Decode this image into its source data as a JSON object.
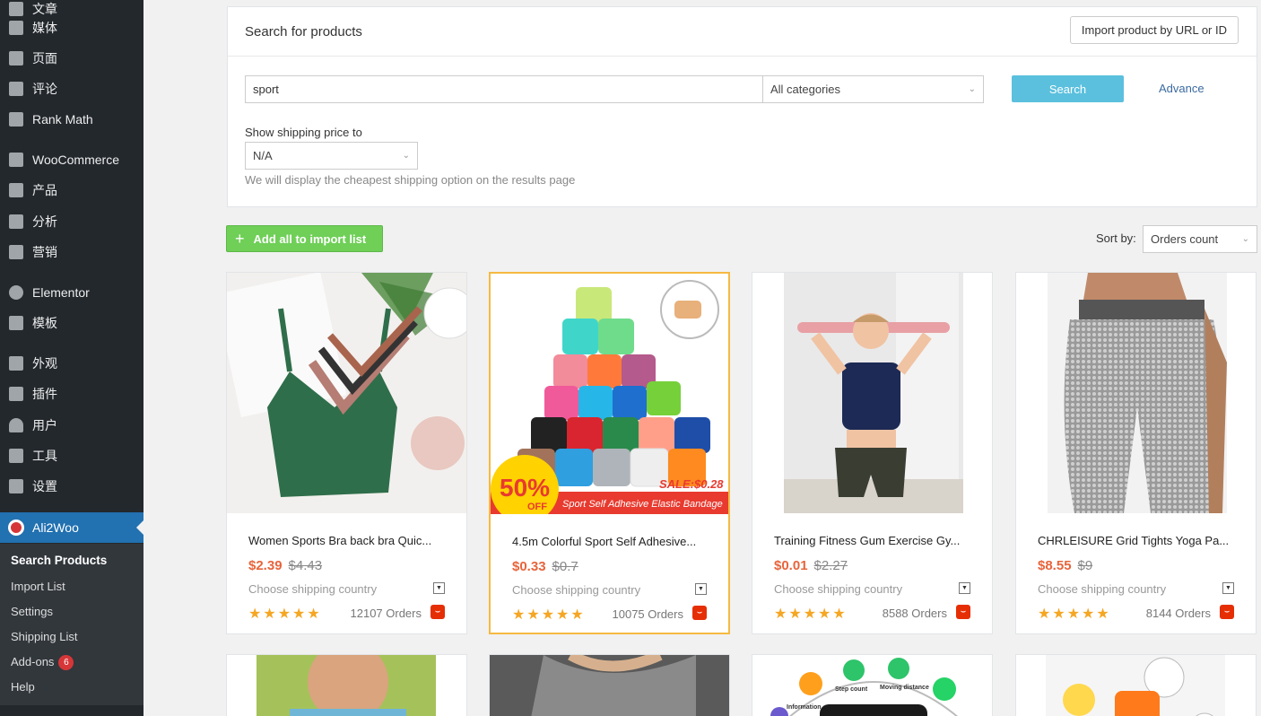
{
  "sidebar": {
    "items": [
      {
        "icon": "posts-icon",
        "label": "文章"
      },
      {
        "icon": "media-icon",
        "label": "媒体"
      },
      {
        "icon": "pages-icon",
        "label": "页面"
      },
      {
        "icon": "comments-icon",
        "label": "评论"
      },
      {
        "icon": "rank-math-icon",
        "label": "Rank Math"
      },
      {
        "icon": "woocommerce-icon",
        "label": "WooCommerce"
      },
      {
        "icon": "products-icon",
        "label": "产品"
      },
      {
        "icon": "analytics-icon",
        "label": "分析"
      },
      {
        "icon": "marketing-icon",
        "label": "营销"
      },
      {
        "icon": "elementor-icon",
        "label": "Elementor"
      },
      {
        "icon": "templates-icon",
        "label": "模板"
      },
      {
        "icon": "appearance-icon",
        "label": "外观"
      },
      {
        "icon": "plugins-icon",
        "label": "插件"
      },
      {
        "icon": "users-icon",
        "label": "用户"
      },
      {
        "icon": "tools-icon",
        "label": "工具"
      },
      {
        "icon": "settings-icon",
        "label": "设置"
      },
      {
        "icon": "ali2woo-icon",
        "label": "Ali2Woo"
      }
    ],
    "submenu": [
      {
        "label": "Search Products"
      },
      {
        "label": "Import List"
      },
      {
        "label": "Settings"
      },
      {
        "label": "Shipping List"
      },
      {
        "label": "Add-ons",
        "badge": "6"
      },
      {
        "label": "Help"
      }
    ]
  },
  "search_panel": {
    "title": "Search for products",
    "import_button": "Import product by URL or ID",
    "query": "sport",
    "category": "All categories",
    "search_button": "Search",
    "advance_link": "Advance",
    "shipping_label": "Show shipping price to",
    "shipping_value": "N/A",
    "shipping_hint": "We will display the cheapest shipping option on the results page"
  },
  "toolbar": {
    "add_all": "Add all to import list",
    "sort_label": "Sort by:",
    "sort_value": "Orders count"
  },
  "products": [
    {
      "title": "Women Sports Bra back bra Quic...",
      "price": "$2.39",
      "old_price": "$4.43",
      "shipping": "Choose shipping country",
      "rating": 5,
      "orders": "12107 Orders"
    },
    {
      "title": "4.5m Colorful Sport Self Adhesive...",
      "price": "$0.33",
      "old_price": "$0.7",
      "shipping": "Choose shipping country",
      "rating": 5,
      "orders": "10075 Orders",
      "banner_sale": "SALE:$0.28",
      "banner_pct": "50%",
      "banner_off": "OFF",
      "banner_caption": "Sport Self Adhesive Elastic Bandage"
    },
    {
      "title": "Training Fitness Gum Exercise Gy...",
      "price": "$0.01",
      "old_price": "$2.27",
      "shipping": "Choose shipping country",
      "rating": 5,
      "orders": "8588 Orders"
    },
    {
      "title": "CHRLEISURE Grid Tights Yoga Pa...",
      "price": "$8.55",
      "old_price": "$9",
      "shipping": "Choose shipping country",
      "rating": 5,
      "orders": "8144 Orders"
    }
  ],
  "product_images_row2": [
    {
      "labels": []
    },
    {
      "labels": []
    },
    {
      "labels": [
        "Step count",
        "Moving distance",
        "Information"
      ]
    },
    {
      "labels": []
    }
  ],
  "colors": {
    "accent": "#2271b1",
    "price": "#e8643b",
    "search_btn": "#5bc0de",
    "add_btn": "#6fcf57"
  }
}
